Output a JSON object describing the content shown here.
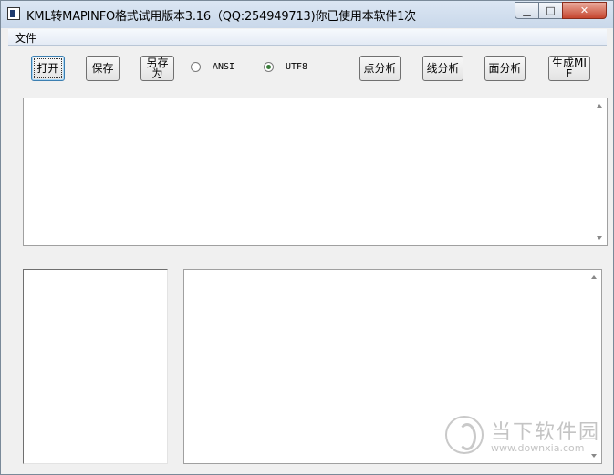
{
  "window": {
    "title": "KML转MAPINFO格式试用版本3.16（QQ:254949713)你已使用本软件1次",
    "minimize_glyph": "▁",
    "maximize_glyph": "□",
    "close_glyph": "✕"
  },
  "menu": {
    "items": [
      {
        "label": "文件"
      }
    ]
  },
  "toolbar": {
    "open_label": "打开",
    "save_label": "保存",
    "save_as_label": "另存为",
    "encoding_ansi_label": "ANSI",
    "encoding_utf8_label": "UTF8",
    "encoding_selected": "UTF8",
    "point_analysis_label": "点分析",
    "line_analysis_label": "线分析",
    "polygon_analysis_label": "面分析",
    "generate_mif_label": "生成MIF"
  },
  "watermark": {
    "text": "当下软件园",
    "url": "www.downxia.com"
  }
}
